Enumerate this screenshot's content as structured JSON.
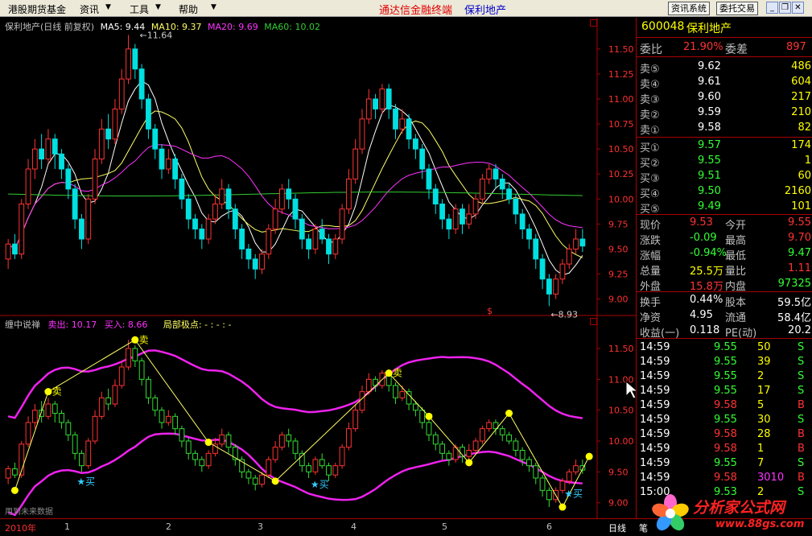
{
  "menu": {
    "items": [
      "港股期货基金",
      "资讯",
      "工具",
      "帮助"
    ],
    "app_title": "通达信金融终端",
    "stock_title": "保利地产",
    "btn_news": "资讯系统",
    "btn_trade": "委托交易"
  },
  "upper": {
    "title": "保利地产(日线 前复权)",
    "ma5": "MA5: 9.44",
    "ma10": "MA10: 9.37",
    "ma20": "MA20: 9.69",
    "ma60": "MA60: 10.02",
    "high_label": "11.64",
    "low_label": "8.93",
    "marker": "$"
  },
  "lower": {
    "title": "缠中说禅",
    "sell": "卖出: 10.17",
    "buy": "买入: 8.66",
    "local": "局部极点: - : - : -",
    "future_note": "用到未来数据",
    "sell_tag": "卖",
    "buy_tag": "买"
  },
  "colors": {
    "up": "#ff3333",
    "down": "#00e0e0",
    "ma5": "#ffffff",
    "ma10": "#ffff66",
    "ma20": "#ff33ff",
    "ma60": "#33cc33",
    "band": "#ee22ee",
    "zig": "#ffff66",
    "green_candle": "#33dd33"
  },
  "quote": {
    "code": "600048",
    "name": "保利地产",
    "weibi_label": "委比",
    "weibi": "21.90%",
    "weicha_label": "委差",
    "weicha": "897",
    "asks": [
      {
        "label": "卖⑤",
        "price": "9.62",
        "vol": "486"
      },
      {
        "label": "卖④",
        "price": "9.61",
        "vol": "604"
      },
      {
        "label": "卖③",
        "price": "9.60",
        "vol": "217"
      },
      {
        "label": "卖②",
        "price": "9.59",
        "vol": "210"
      },
      {
        "label": "卖①",
        "price": "9.58",
        "vol": "82"
      }
    ],
    "bids": [
      {
        "label": "买①",
        "price": "9.57",
        "vol": "174"
      },
      {
        "label": "买②",
        "price": "9.55",
        "vol": "1"
      },
      {
        "label": "买③",
        "price": "9.51",
        "vol": "60"
      },
      {
        "label": "买④",
        "price": "9.50",
        "vol": "2160"
      },
      {
        "label": "买⑤",
        "price": "9.49",
        "vol": "101"
      }
    ],
    "stats": [
      {
        "l1": "现价",
        "v1": "9.53",
        "c1": "red",
        "l2": "今开",
        "v2": "9.55",
        "c2": "red"
      },
      {
        "l1": "涨跌",
        "v1": "-0.09",
        "c1": "green",
        "l2": "最高",
        "v2": "9.70",
        "c2": "red"
      },
      {
        "l1": "涨幅",
        "v1": "-0.94%",
        "c1": "green",
        "l2": "最低",
        "v2": "9.47",
        "c2": "green"
      },
      {
        "l1": "总量",
        "v1": "25.5万",
        "c1": "yellow",
        "l2": "量比",
        "v2": "1.11",
        "c2": "red"
      },
      {
        "l1": "外盘",
        "v1": "15.8万",
        "c1": "red",
        "l2": "内盘",
        "v2": "97325",
        "c2": "green"
      }
    ],
    "fin": [
      {
        "l1": "换手",
        "v1": "0.44%",
        "l2": "股本",
        "v2": "59.5亿"
      },
      {
        "l1": "净资",
        "v1": "4.95",
        "l2": "流通",
        "v2": "58.4亿"
      },
      {
        "l1": "收益(一)",
        "v1": "0.118",
        "l2": "PE(动)",
        "v2": "20.2"
      }
    ],
    "ticks": [
      {
        "t": "14:59",
        "p": "9.55",
        "pc": "green",
        "v": "50",
        "s": "S"
      },
      {
        "t": "14:59",
        "p": "9.55",
        "pc": "green",
        "v": "39",
        "s": "S"
      },
      {
        "t": "14:59",
        "p": "9.55",
        "pc": "green",
        "v": "2",
        "s": "S"
      },
      {
        "t": "14:59",
        "p": "9.55",
        "pc": "green",
        "v": "17",
        "s": "S"
      },
      {
        "t": "14:59",
        "p": "9.58",
        "pc": "red",
        "v": "5",
        "s": "B"
      },
      {
        "t": "14:59",
        "p": "9.55",
        "pc": "green",
        "v": "30",
        "s": "S"
      },
      {
        "t": "14:59",
        "p": "9.58",
        "pc": "red",
        "v": "28",
        "s": "B"
      },
      {
        "t": "14:59",
        "p": "9.58",
        "pc": "red",
        "v": "1",
        "s": "B"
      },
      {
        "t": "14:59",
        "p": "9.55",
        "pc": "green",
        "v": "7",
        "s": "S"
      },
      {
        "t": "14:59",
        "p": "9.58",
        "pc": "red",
        "v": "3010",
        "s": "B"
      },
      {
        "t": "15:00",
        "p": "9.53",
        "pc": "green",
        "v": "2",
        "s": "S"
      }
    ]
  },
  "bottom": {
    "year": "2010年",
    "months": [
      "1",
      "2",
      "3",
      "4",
      "5",
      "6"
    ],
    "period": "日线",
    "extra": "笔"
  },
  "logo": {
    "text": "分析家公式网",
    "url": "www.88gs.com"
  },
  "chart_data": {
    "type": "candlestick",
    "upper_axis": {
      "ticks": [
        9.0,
        9.25,
        9.5,
        9.75,
        10.0,
        10.25,
        10.5,
        10.75,
        11.0,
        11.25,
        11.5
      ],
      "ylim": [
        8.9,
        11.7
      ]
    },
    "lower_axis": {
      "ticks": [
        9.0,
        9.5,
        10.0,
        10.5,
        11.0,
        11.5
      ],
      "ylim": [
        8.8,
        11.8
      ]
    },
    "candles": [
      [
        9.4,
        9.55,
        9.3,
        9.6
      ],
      [
        9.55,
        9.45,
        9.4,
        9.65
      ],
      [
        9.45,
        9.95,
        9.4,
        10.0
      ],
      [
        9.95,
        10.3,
        9.9,
        10.4
      ],
      [
        10.3,
        10.5,
        10.2,
        10.6
      ],
      [
        10.5,
        10.4,
        10.3,
        10.65
      ],
      [
        10.4,
        10.6,
        10.35,
        10.7
      ],
      [
        10.6,
        10.45,
        10.3,
        10.65
      ],
      [
        10.45,
        10.3,
        10.2,
        10.5
      ],
      [
        10.3,
        10.1,
        10.0,
        10.35
      ],
      [
        10.1,
        9.8,
        9.7,
        10.15
      ],
      [
        9.8,
        9.6,
        9.5,
        9.85
      ],
      [
        9.6,
        10.0,
        9.55,
        10.05
      ],
      [
        10.0,
        10.4,
        9.95,
        10.5
      ],
      [
        10.4,
        10.7,
        10.35,
        10.8
      ],
      [
        10.7,
        10.6,
        10.5,
        10.85
      ],
      [
        10.6,
        10.9,
        10.55,
        11.0
      ],
      [
        10.9,
        11.2,
        10.85,
        11.3
      ],
      [
        11.2,
        11.5,
        11.15,
        11.64
      ],
      [
        11.5,
        11.3,
        11.2,
        11.55
      ],
      [
        11.3,
        11.0,
        10.9,
        11.35
      ],
      [
        11.0,
        10.7,
        10.6,
        11.05
      ],
      [
        10.7,
        10.5,
        10.4,
        10.75
      ],
      [
        10.5,
        10.3,
        10.2,
        10.55
      ],
      [
        10.3,
        10.4,
        10.25,
        10.5
      ],
      [
        10.4,
        10.2,
        10.1,
        10.45
      ],
      [
        10.2,
        10.0,
        9.9,
        10.25
      ],
      [
        10.0,
        9.8,
        9.7,
        10.05
      ],
      [
        9.8,
        9.7,
        9.6,
        9.85
      ],
      [
        9.7,
        9.6,
        9.5,
        9.75
      ],
      [
        9.6,
        9.8,
        9.55,
        9.85
      ],
      [
        9.8,
        9.95,
        9.75,
        10.05
      ],
      [
        9.95,
        10.1,
        9.9,
        10.2
      ],
      [
        10.1,
        9.9,
        9.8,
        10.15
      ],
      [
        9.9,
        9.7,
        9.6,
        9.95
      ],
      [
        9.7,
        9.5,
        9.4,
        9.75
      ],
      [
        9.5,
        9.4,
        9.3,
        9.55
      ],
      [
        9.4,
        9.3,
        9.2,
        9.45
      ],
      [
        9.3,
        9.45,
        9.25,
        9.5
      ],
      [
        9.45,
        9.7,
        9.4,
        9.75
      ],
      [
        9.7,
        9.9,
        9.65,
        10.0
      ],
      [
        9.9,
        10.1,
        9.85,
        10.15
      ],
      [
        10.1,
        10.0,
        9.9,
        10.2
      ],
      [
        10.0,
        9.8,
        9.7,
        10.05
      ],
      [
        9.8,
        9.6,
        9.5,
        9.85
      ],
      [
        9.6,
        9.5,
        9.4,
        9.65
      ],
      [
        9.5,
        9.7,
        9.45,
        9.75
      ],
      [
        9.7,
        9.6,
        9.55,
        9.8
      ],
      [
        9.6,
        9.45,
        9.35,
        9.65
      ],
      [
        9.45,
        9.6,
        9.4,
        9.65
      ],
      [
        9.6,
        9.9,
        9.55,
        9.95
      ],
      [
        9.9,
        10.2,
        9.85,
        10.3
      ],
      [
        10.2,
        10.5,
        10.15,
        10.6
      ],
      [
        10.5,
        10.8,
        10.45,
        10.9
      ],
      [
        10.8,
        11.0,
        10.75,
        11.1
      ],
      [
        11.0,
        10.9,
        10.8,
        11.05
      ],
      [
        10.9,
        11.1,
        10.85,
        11.15
      ],
      [
        11.1,
        10.9,
        10.8,
        11.15
      ],
      [
        10.9,
        10.7,
        10.6,
        10.95
      ],
      [
        10.7,
        10.8,
        10.65,
        10.9
      ],
      [
        10.8,
        10.6,
        10.5,
        10.85
      ],
      [
        10.6,
        10.5,
        10.4,
        10.65
      ],
      [
        10.5,
        10.3,
        10.2,
        10.55
      ],
      [
        10.3,
        10.1,
        10.0,
        10.35
      ],
      [
        10.1,
        9.95,
        9.85,
        10.15
      ],
      [
        9.95,
        9.8,
        9.7,
        10.0
      ],
      [
        9.8,
        9.7,
        9.6,
        9.85
      ],
      [
        9.7,
        9.9,
        9.65,
        9.95
      ],
      [
        9.9,
        9.75,
        9.65,
        9.95
      ],
      [
        9.75,
        9.85,
        9.7,
        9.95
      ],
      [
        9.85,
        10.0,
        9.8,
        10.05
      ],
      [
        10.0,
        10.2,
        9.95,
        10.25
      ],
      [
        10.2,
        10.3,
        10.15,
        10.35
      ],
      [
        10.3,
        10.2,
        10.1,
        10.35
      ],
      [
        10.2,
        10.1,
        10.0,
        10.25
      ],
      [
        10.1,
        10.0,
        9.95,
        10.15
      ],
      [
        10.0,
        9.85,
        9.75,
        10.05
      ],
      [
        9.85,
        9.7,
        9.6,
        9.9
      ],
      [
        9.7,
        9.6,
        9.5,
        9.75
      ],
      [
        9.6,
        9.4,
        9.3,
        9.65
      ],
      [
        9.4,
        9.2,
        9.1,
        9.45
      ],
      [
        9.2,
        9.05,
        8.93,
        9.25
      ],
      [
        9.05,
        9.2,
        9.0,
        9.25
      ],
      [
        9.2,
        9.35,
        9.15,
        9.4
      ],
      [
        9.35,
        9.5,
        9.3,
        9.55
      ],
      [
        9.5,
        9.6,
        9.45,
        9.7
      ],
      [
        9.6,
        9.53,
        9.47,
        9.7
      ]
    ],
    "zigzag": [
      [
        1,
        9.2
      ],
      [
        6,
        10.8
      ],
      [
        19,
        11.64
      ],
      [
        30,
        9.98
      ],
      [
        40,
        9.35
      ],
      [
        57,
        11.1
      ],
      [
        63,
        10.4
      ],
      [
        69,
        9.65
      ],
      [
        75,
        10.45
      ],
      [
        83,
        8.93
      ],
      [
        87,
        9.75
      ]
    ],
    "sell_points": [
      6,
      19,
      57
    ],
    "buy_points": [
      11,
      46,
      84
    ]
  }
}
